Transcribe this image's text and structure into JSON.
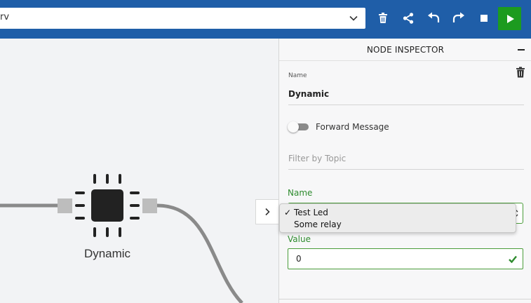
{
  "toolbar": {
    "flow_select_value": "rv",
    "icons": [
      "trash-icon",
      "share-icon",
      "undo-icon",
      "redo-icon",
      "stop-icon",
      "play-icon"
    ],
    "colors": {
      "bar": "#1f5ea8",
      "play": "#1c9b1f"
    }
  },
  "canvas": {
    "node_label": "Dynamic",
    "node_icon": "chip-icon"
  },
  "inspector": {
    "title": "NODE INSPECTOR",
    "name_label": "Name",
    "name_value": "Dynamic",
    "forward_message_label": "Forward Message",
    "forward_message_enabled": false,
    "topic_placeholder": "Filter by Topic",
    "device_name_label": "Name",
    "device_options": [
      {
        "label": "Test Led",
        "selected": true
      },
      {
        "label": "Some relay",
        "selected": false
      }
    ],
    "value_label": "Value",
    "value": "0",
    "accent_color": "#2e8b2e"
  }
}
